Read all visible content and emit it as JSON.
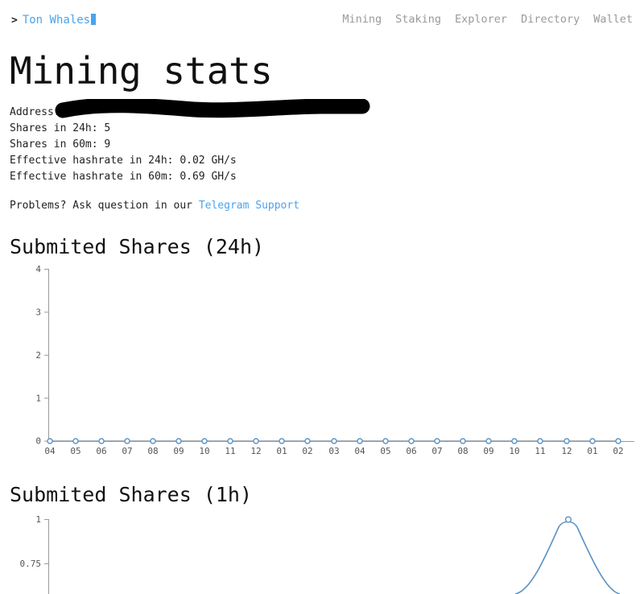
{
  "nav": {
    "brand_prompt": ">",
    "brand_name": "Ton Whales",
    "links": [
      {
        "label": "Mining"
      },
      {
        "label": "Staking"
      },
      {
        "label": "Explorer"
      },
      {
        "label": "Directory"
      },
      {
        "label": "Wallet"
      }
    ]
  },
  "page": {
    "title": "Mining stats"
  },
  "stats": {
    "address_label": "Address:",
    "address_value": "",
    "shares_24h": "Shares in 24h: 5",
    "shares_60m": "Shares in 60m: 9",
    "hashrate_24h": "Effective hashrate in 24h: 0.02 GH/s",
    "hashrate_60m": "Effective hashrate in 60m: 0.69 GH/s"
  },
  "support": {
    "prefix": "Problems? Ask question in our",
    "link_label": "Telegram Support"
  },
  "colors": {
    "link": "#4aa3ef",
    "nav_text": "#9a9a9a",
    "series": "#5b92c4",
    "axis": "#999999",
    "redaction": "#000000"
  },
  "chart_data": [
    {
      "type": "line",
      "title": "Submited Shares (24h)",
      "xlabel": "",
      "ylabel": "",
      "ylim": [
        0,
        4
      ],
      "y_ticks": [
        0,
        1,
        2,
        3,
        4
      ],
      "y_tick_labels": [
        "0",
        "1",
        "2",
        "3",
        "4"
      ],
      "grid": false,
      "legend": "none",
      "categories": [
        "04",
        "05",
        "06",
        "07",
        "08",
        "09",
        "10",
        "11",
        "12",
        "01",
        "02",
        "03",
        "04",
        "05",
        "06",
        "07",
        "08",
        "09",
        "10",
        "11",
        "12",
        "01",
        "02"
      ],
      "values": [
        0,
        0,
        0,
        0,
        0,
        0,
        0,
        0,
        0,
        0,
        0,
        0,
        0,
        0,
        0,
        0,
        0,
        0,
        0,
        0,
        0,
        0,
        0
      ],
      "markers": true
    },
    {
      "type": "line",
      "title": "Submited Shares (1h)",
      "xlabel": "",
      "ylabel": "",
      "ylim": [
        0,
        1
      ],
      "y_ticks": [
        1,
        0.75
      ],
      "y_tick_labels": [
        "1",
        "0.75"
      ],
      "grid": false,
      "legend": "none",
      "note": "chart cropped by viewport bottom; single peak of value 1 near right edge",
      "categories": [
        "",
        "",
        ""
      ],
      "values": [
        0,
        1,
        0
      ],
      "peak_value": 1,
      "markers": true
    }
  ]
}
